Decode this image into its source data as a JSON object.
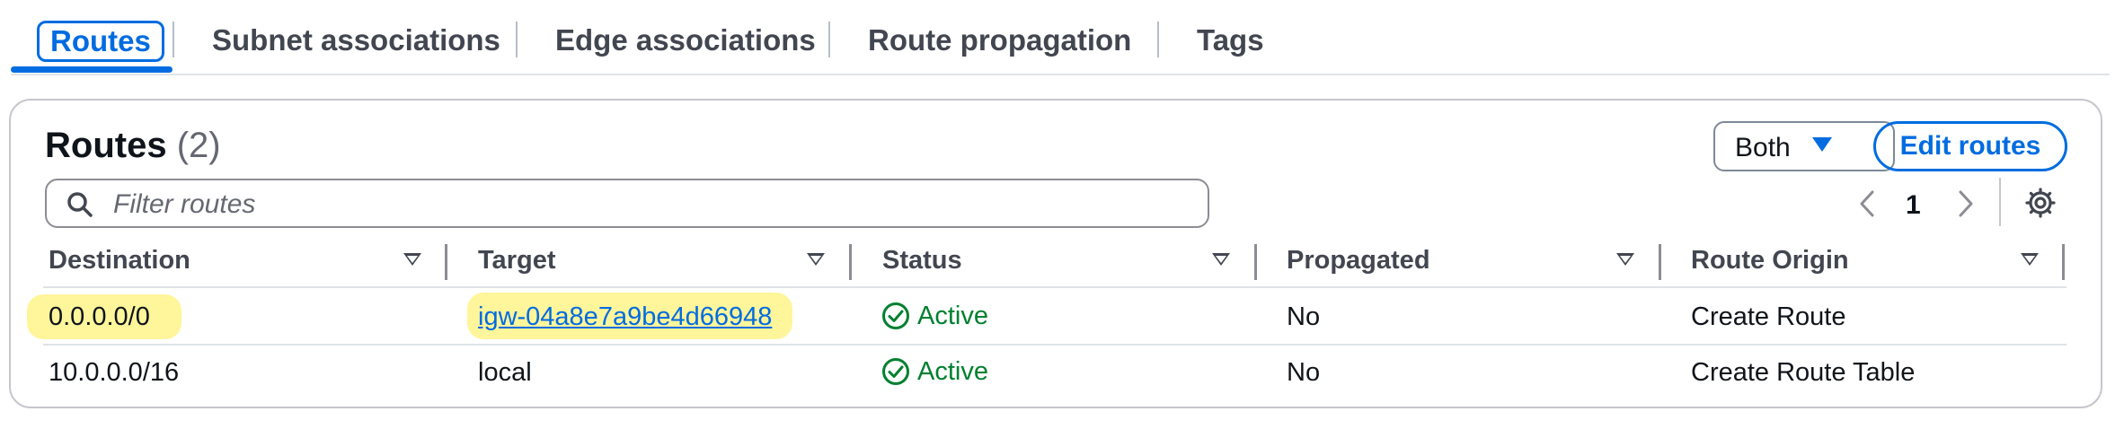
{
  "tabs": [
    {
      "label": "Routes",
      "active": true
    },
    {
      "label": "Subnet associations"
    },
    {
      "label": "Edge associations"
    },
    {
      "label": "Route propagation"
    },
    {
      "label": "Tags"
    }
  ],
  "routes": {
    "title": "Routes",
    "count": "(2)",
    "select_label": "Both",
    "edit_label": "Edit routes",
    "filter_placeholder": "Filter routes",
    "page": "1"
  },
  "table": {
    "columns": [
      "Destination",
      "Target",
      "Status",
      "Propagated",
      "Route Origin"
    ],
    "rows": [
      {
        "destination": "0.0.0.0/0",
        "target": "igw-04a8e7a9be4d66948",
        "target_is_link": true,
        "status": "Active",
        "propagated": "No",
        "origin": "Create Route",
        "highlighted": true
      },
      {
        "destination": "10.0.0.0/16",
        "target": "local",
        "target_is_link": false,
        "status": "Active",
        "propagated": "No",
        "origin": "Create Route Table",
        "highlighted": false
      }
    ]
  },
  "colors": {
    "accent": "#006ce0",
    "success": "#00802f",
    "highlight": "#fff59b"
  },
  "icons": [
    "search-icon",
    "chevron-left-icon",
    "chevron-right-icon",
    "gear-icon",
    "check-circle-icon",
    "caret-down-icon",
    "sort-icon"
  ]
}
